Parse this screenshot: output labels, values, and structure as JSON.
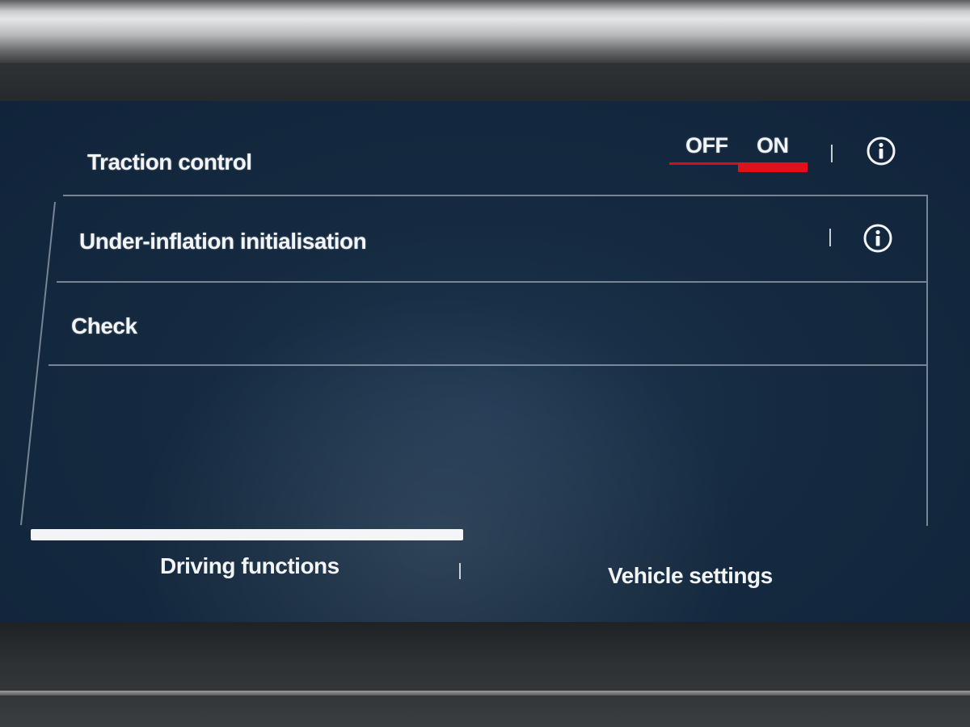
{
  "settings": [
    {
      "label": "Traction control",
      "toggle": {
        "off_label": "OFF",
        "on_label": "ON",
        "state": "ON"
      },
      "has_info": true
    },
    {
      "label": "Under-inflation initialisation",
      "has_info": true
    },
    {
      "label": "Check"
    }
  ],
  "tabs": [
    {
      "label": "Driving functions",
      "active": true
    },
    {
      "label": "Vehicle settings",
      "active": false
    }
  ],
  "colors": {
    "accent": "#e0101e",
    "screen_bg": "#152a40",
    "text": "#f2f4f6"
  },
  "icons": [
    "info-icon"
  ]
}
